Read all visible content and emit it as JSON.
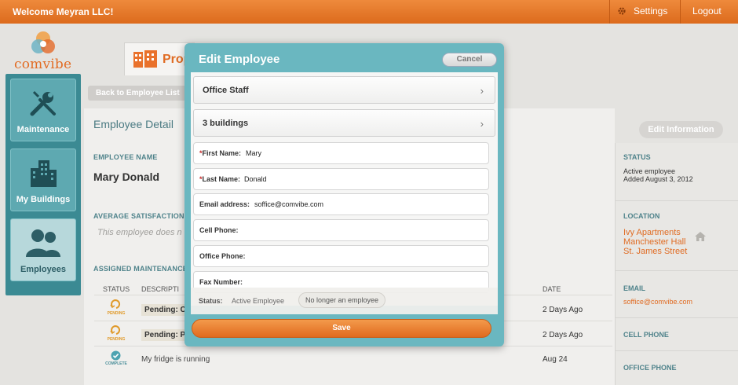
{
  "topbar": {
    "welcome": "Welcome Meyran LLC!",
    "settings": "Settings",
    "logout": "Logout"
  },
  "logo": {
    "word": "comvibe"
  },
  "sidebar": {
    "items": [
      {
        "label": "Maintenance",
        "icon": "wrench-screwdriver-icon"
      },
      {
        "label": "My Buildings",
        "icon": "buildings-icon"
      },
      {
        "label": "Employees",
        "icon": "people-icon"
      }
    ]
  },
  "tab": {
    "label": "Prop"
  },
  "page": {
    "back": "Back to Employee List",
    "title": "Employee Detail",
    "edit_info": "Edit Information",
    "employee_name_label": "EMPLOYEE NAME",
    "employee_name": "Mary Donald",
    "avg_label": "AVERAGE SATISFACTION F",
    "avg_text": "This employee does n",
    "assigned_label": "ASSIGNED MAINTENANCE I",
    "columns": {
      "status": "STATUS",
      "description": "DESCRIPTI",
      "date": "DATE"
    },
    "rows": [
      {
        "status": "PENDING",
        "desc": "Pending: Co",
        "date": "2 Days Ago"
      },
      {
        "status": "PENDING",
        "desc": "Pending: Pa",
        "date": "2 Days Ago"
      },
      {
        "status": "COMPLETE",
        "desc": "My fridge is running",
        "date": "Aug 24"
      }
    ]
  },
  "right": {
    "status_label": "STATUS",
    "status_value": "Active employee",
    "status_added": "Added August 3, 2012",
    "location_label": "LOCATION",
    "locations": [
      "Ivy Apartments",
      "Manchester Hall",
      "St. James Street"
    ],
    "email_label": "EMAIL",
    "email": "soffice@comvibe.com",
    "cell_label": "CELL PHONE",
    "office_label": "OFFICE PHONE"
  },
  "modal": {
    "title": "Edit Employee",
    "cancel": "Cancel",
    "role": "Office Staff",
    "buildings": "3 buildings",
    "fields": [
      {
        "label": "First Name:",
        "value": "Mary",
        "required": true
      },
      {
        "label": "Last Name:",
        "value": "Donald",
        "required": true
      },
      {
        "label": "Email address:",
        "value": "soffice@comvibe.com",
        "required": false
      },
      {
        "label": "Cell Phone:",
        "value": "",
        "required": false
      },
      {
        "label": "Office Phone:",
        "value": "",
        "required": false
      },
      {
        "label": "Fax Number:",
        "value": "",
        "required": false
      }
    ],
    "status_label": "Status:",
    "status_value": "Active Employee",
    "no_longer": "No longer an employee",
    "save": "Save"
  },
  "colors": {
    "accent": "#e06c24",
    "teal": "#6ab7c0",
    "sidebar": "#3b8a93"
  }
}
